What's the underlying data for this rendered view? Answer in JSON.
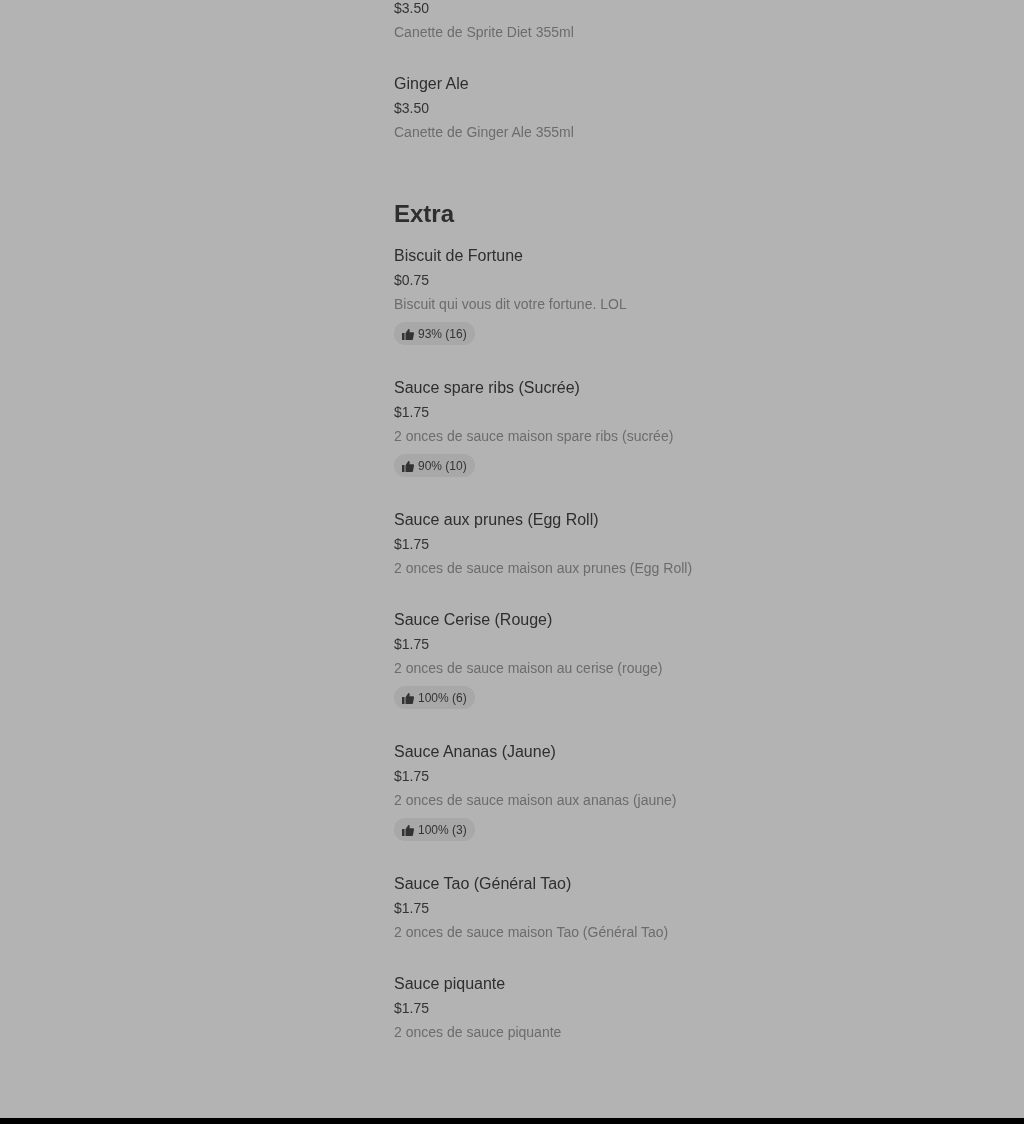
{
  "sections": [
    {
      "items": [
        {
          "price": "$3.50",
          "description": "Canette de Sprite Diet 355ml"
        },
        {
          "name": "Ginger Ale",
          "price": "$3.50",
          "description": "Canette de Ginger Ale 355ml"
        }
      ]
    },
    {
      "title": "Extra",
      "items": [
        {
          "name": "Biscuit de Fortune",
          "price": "$0.75",
          "description": "Biscuit qui vous dit votre fortune. LOL",
          "rating": "93% (16)"
        },
        {
          "name": "Sauce spare ribs (Sucrée)",
          "price": "$1.75",
          "description": "2 onces de sauce maison spare ribs (sucrée)",
          "rating": "90% (10)"
        },
        {
          "name": "Sauce aux prunes (Egg Roll)",
          "price": "$1.75",
          "description": "2 onces de sauce maison aux prunes (Egg Roll)"
        },
        {
          "name": "Sauce Cerise (Rouge)",
          "price": "$1.75",
          "description": "2 onces de sauce maison au cerise (rouge)",
          "rating": "100% (6)"
        },
        {
          "name": "Sauce Ananas (Jaune)",
          "price": "$1.75",
          "description": "2 onces de sauce maison aux ananas (jaune)",
          "rating": "100% (3)"
        },
        {
          "name": "Sauce Tao (Général Tao)",
          "price": "$1.75",
          "description": "2 onces de sauce maison Tao (Général Tao)"
        },
        {
          "name": "Sauce piquante",
          "price": "$1.75",
          "description": "2 onces de sauce piquante"
        }
      ]
    }
  ]
}
